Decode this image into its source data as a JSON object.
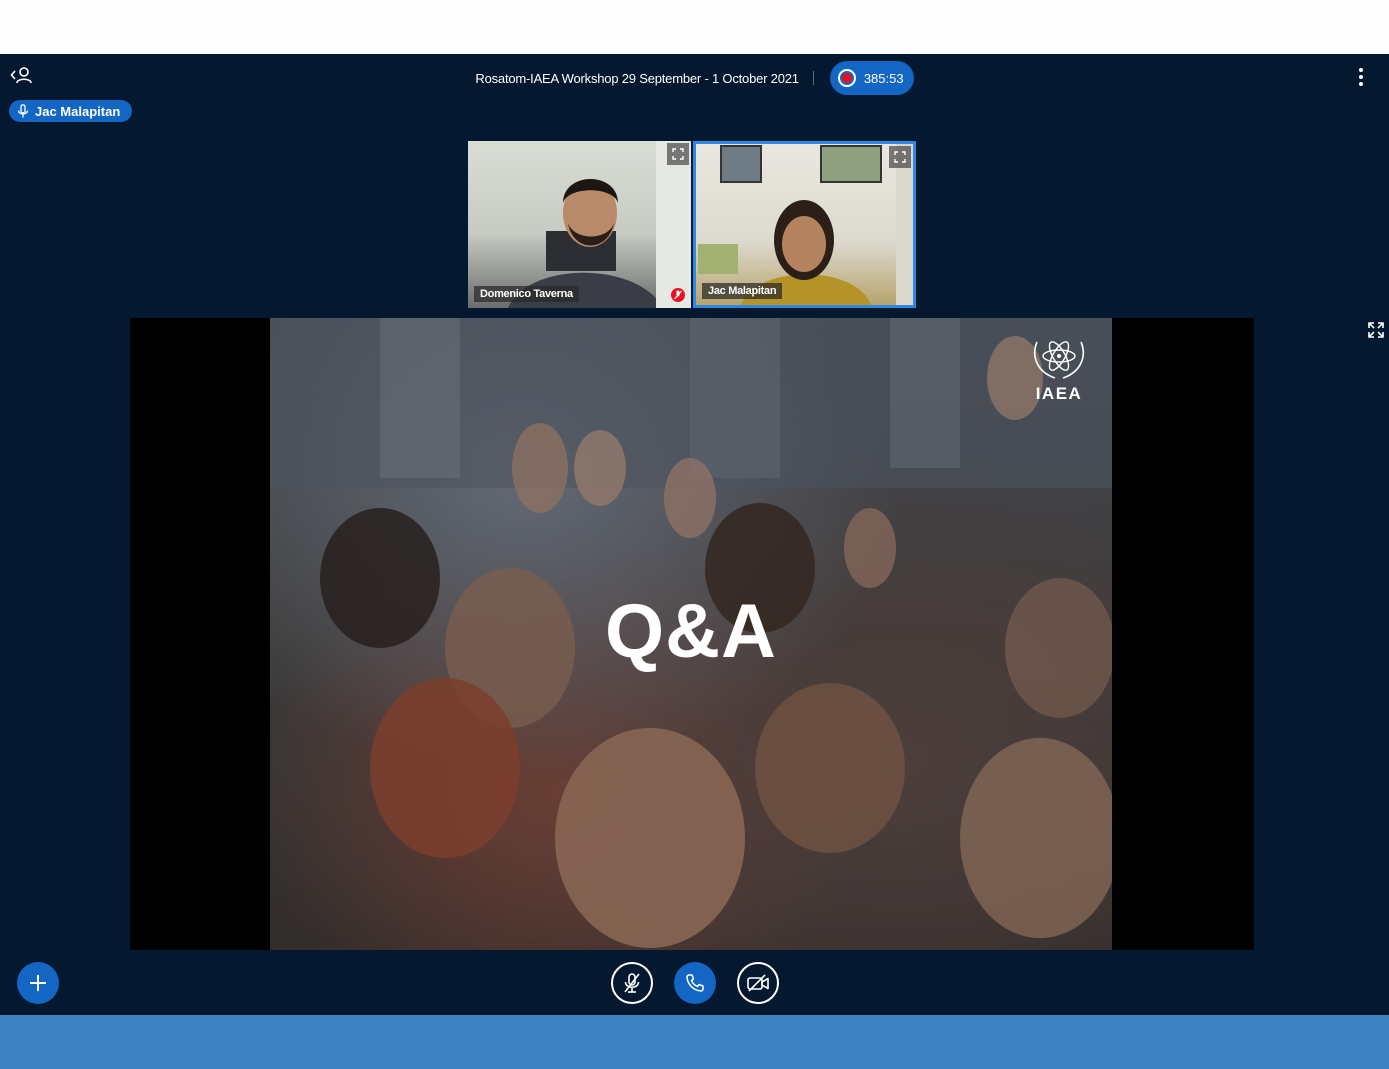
{
  "header": {
    "call_title": "Rosatom-IAEA Workshop 29 September - 1 October 2021",
    "recording_timer": "385:53"
  },
  "active_speaker": {
    "name": "Jac Malapitan"
  },
  "participants": [
    {
      "name": "Domenico Taverna",
      "muted": true
    },
    {
      "name": "Jac Malapitan",
      "muted": false,
      "active": true
    }
  ],
  "shared_content": {
    "slide_title": "Q&A",
    "logo_text": "IAEA"
  },
  "colors": {
    "app_background": "#04192f",
    "accent": "#1466c4",
    "record_red": "#e81123",
    "active_tile_border": "#2e88e0",
    "bottom_bar": "#3f82c4"
  },
  "icons": {
    "roster": "person-back-icon",
    "microphone": "microphone-icon",
    "more": "more-vertical-icon",
    "expand": "expand-icon",
    "add": "plus-icon",
    "mute_mic": "microphone-off-icon",
    "hang_up": "phone-icon",
    "camera_off": "camera-off-icon"
  }
}
